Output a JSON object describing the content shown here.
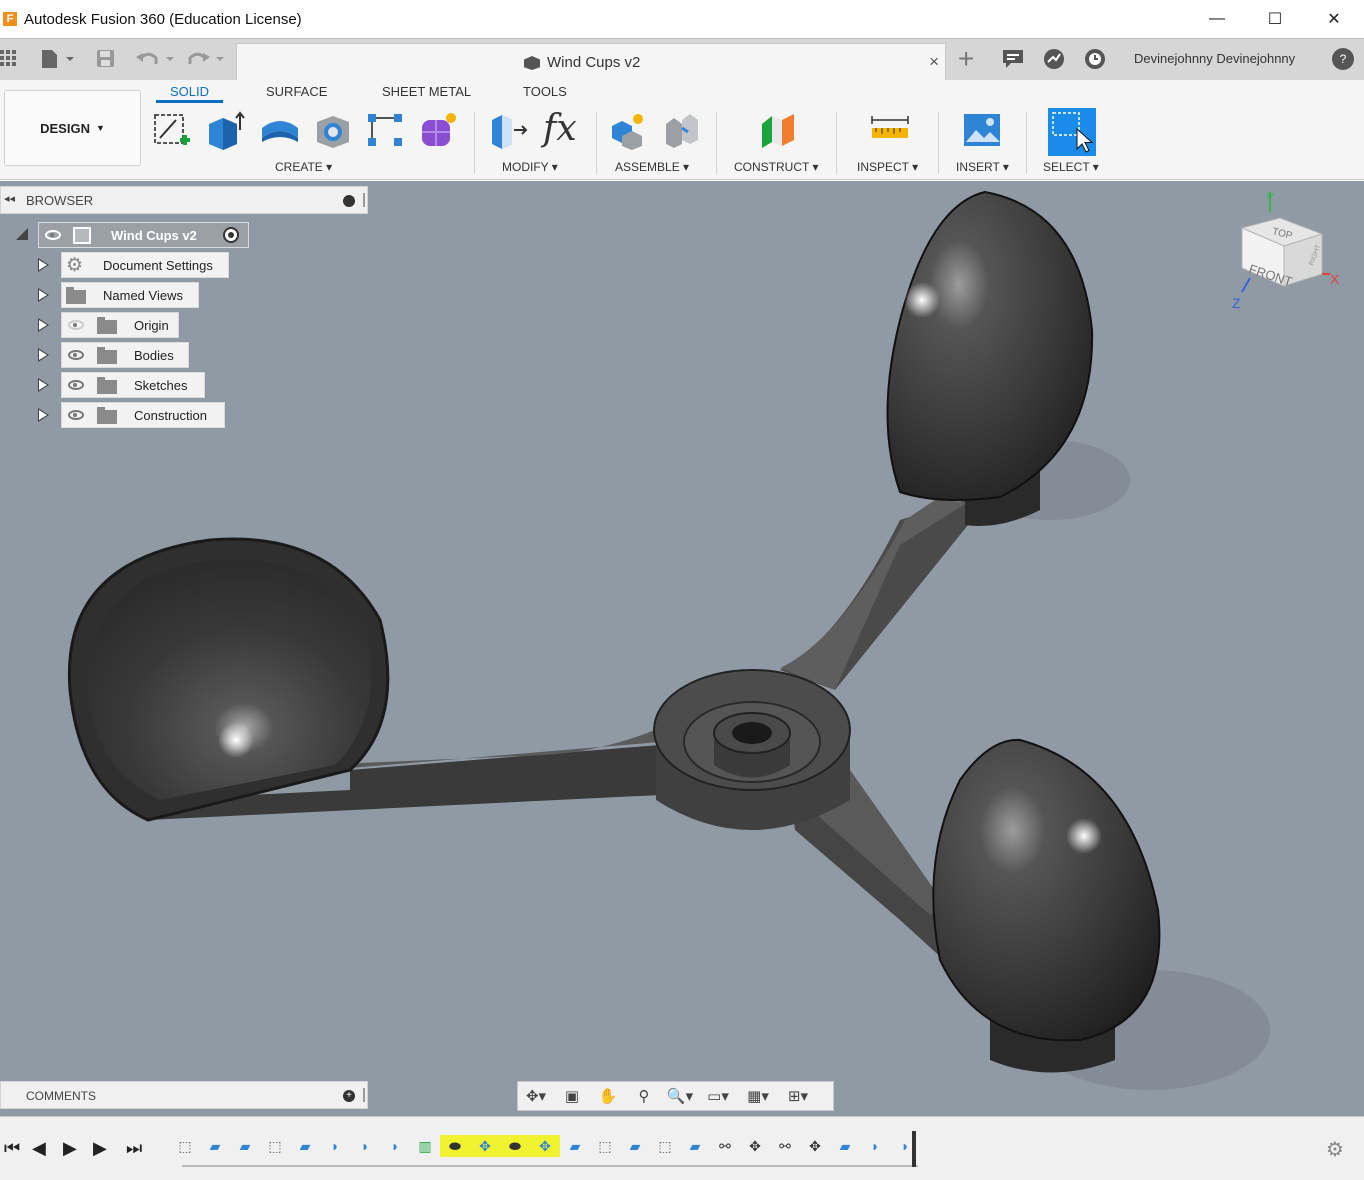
{
  "titlebar": {
    "app_logo_letter": "F",
    "title": "Autodesk Fusion 360 (Education License)",
    "minimize_glyph": "—",
    "maximize_glyph": "☐",
    "close_glyph": "✕"
  },
  "tabbar": {
    "document_tab": "Wind Cups v2",
    "close_tab_glyph": "×",
    "new_tab_glyph": "+",
    "user_name": "Devinejohnny Devinejohnny",
    "help_glyph": "?"
  },
  "ribbon": {
    "workspace": "DESIGN",
    "tabs": [
      "SOLID",
      "SURFACE",
      "SHEET METAL",
      "TOOLS"
    ],
    "active_tab": "SOLID",
    "groups": [
      "CREATE",
      "MODIFY",
      "ASSEMBLE",
      "CONSTRUCT",
      "INSPECT",
      "INSERT",
      "SELECT"
    ],
    "accent_color": "#0b6fc4"
  },
  "browser": {
    "title": "BROWSER",
    "root": "Wind Cups v2",
    "items": [
      "Document Settings",
      "Named Views",
      "Origin",
      "Bodies",
      "Sketches",
      "Construction"
    ]
  },
  "viewcube": {
    "top_label": "TOP",
    "front_label": "FRONT",
    "right_label": "RIGHT",
    "x_axis": "X",
    "y_axis": "Y",
    "z_axis": "Z"
  },
  "comments": {
    "label": "COMMENTS",
    "add_glyph": "+"
  },
  "navbar": {
    "tools": [
      "orbit-icon",
      "look-at-icon",
      "pan-icon",
      "zoom-icon",
      "fit-icon",
      "display-settings-icon",
      "grid-icon",
      "viewports-icon"
    ]
  },
  "timeline": {
    "controls": [
      "first-frame",
      "previous-frame",
      "play",
      "next-frame",
      "last-frame"
    ],
    "highlight_color": "#f1f230"
  }
}
